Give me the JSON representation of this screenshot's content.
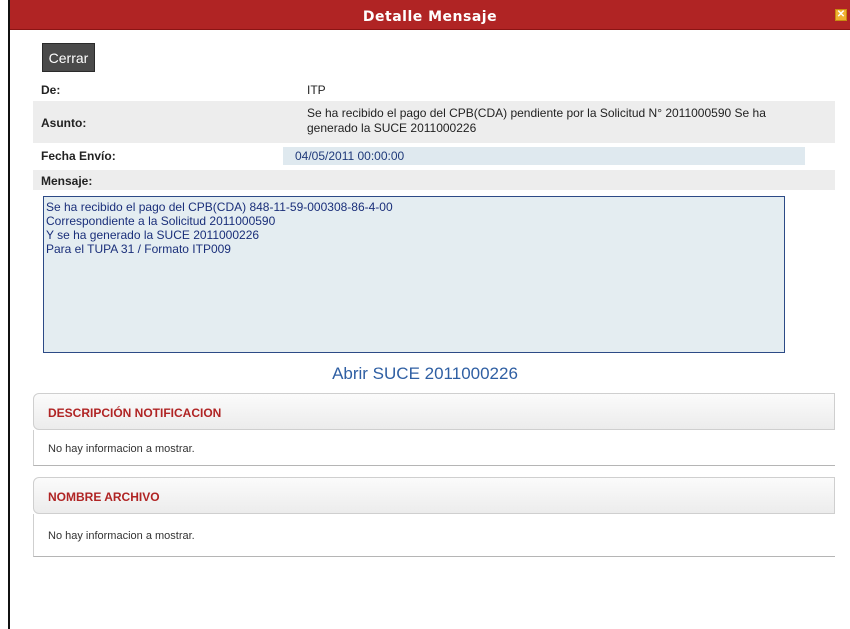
{
  "window": {
    "title": "Detalle Mensaje",
    "close_glyph": "✕",
    "title_bar_color": "#b02424"
  },
  "toolbar": {
    "close_label": "Cerrar"
  },
  "fields": {
    "de_label": "De:",
    "de_value": "ITP",
    "asunto_label": "Asunto:",
    "asunto_value_line1": "Se ha recibido el pago del CPB(CDA) pendiente por la Solicitud N° 2011000590 Se ha",
    "asunto_value_line2": "generado la SUCE 2011000226",
    "fecha_label": "Fecha Envío:",
    "fecha_value": "04/05/2011 00:00:00",
    "mensaje_label": "Mensaje:"
  },
  "message": {
    "lines": [
      "Se ha recibido el pago del CPB(CDA) 848-11-59-000308-86-4-00",
      "Correspondiente a la Solicitud 2011000590",
      "Y se ha generado la SUCE  2011000226",
      "Para el TUPA 31 / Formato ITP009"
    ]
  },
  "link": {
    "open_suce": "Abrir SUCE 2011000226"
  },
  "sections": [
    {
      "title": "DESCRIPCIÓN NOTIFICACION",
      "empty_text": "No hay informacion a mostrar."
    },
    {
      "title": "NOMBRE ARCHIVO",
      "empty_text": "No hay informacion a mostrar."
    }
  ]
}
